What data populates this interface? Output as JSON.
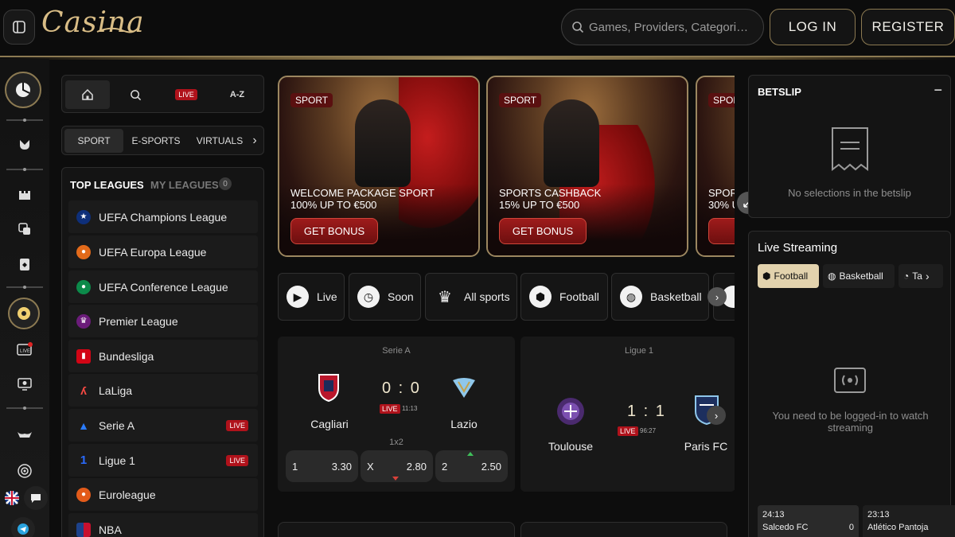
{
  "header": {
    "logo_text": "Casina",
    "search_placeholder": "Games, Providers, Categori…",
    "login_label": "LOG IN",
    "register_label": "REGISTER"
  },
  "nav": {
    "home_icon": "home-icon",
    "search_icon": "search-icon",
    "live_label": "LIVE",
    "az_label": "A-Z"
  },
  "tabs": [
    {
      "label": "SPORT"
    },
    {
      "label": "E-SPORTS"
    },
    {
      "label": "VIRTUALS"
    }
  ],
  "leagues": {
    "top_label": "TOP LEAGUES",
    "my_label": "MY LEAGUES",
    "my_count": "0",
    "items": [
      {
        "name": "UEFA Champions League",
        "live": ""
      },
      {
        "name": "UEFA Europa League",
        "live": ""
      },
      {
        "name": "UEFA Conference League",
        "live": ""
      },
      {
        "name": "Premier League",
        "live": ""
      },
      {
        "name": "Bundesliga",
        "live": ""
      },
      {
        "name": "LaLiga",
        "live": ""
      },
      {
        "name": "Serie A",
        "live": "LIVE"
      },
      {
        "name": "Ligue 1",
        "live": "LIVE"
      },
      {
        "name": "Euroleague",
        "live": ""
      },
      {
        "name": "NBA",
        "live": ""
      }
    ]
  },
  "banners": [
    {
      "badge": "SPORT",
      "line1": "WELCOME PACKAGE SPORT",
      "line2": "100% UP TO €500",
      "cta": "GET BONUS"
    },
    {
      "badge": "SPORT",
      "line1": "SPORTS CASHBACK",
      "line2": "15% UP TO €500",
      "cta": "GET BONUS"
    },
    {
      "badge": "SPOR",
      "line1": "SPOR",
      "line2": "30% U",
      "cta": "GE"
    }
  ],
  "sports": [
    {
      "label": "Live",
      "icon": "play-icon"
    },
    {
      "label": "Soon",
      "icon": "clock-icon"
    },
    {
      "label": "All sports",
      "icon": "trophy-icon"
    },
    {
      "label": "Football",
      "icon": "football-icon"
    },
    {
      "label": "Basketball",
      "icon": "basketball-icon"
    }
  ],
  "matches": [
    {
      "league": "Serie A",
      "home": "Cagliari",
      "away": "Lazio",
      "score": "0 : 0",
      "live": "LIVE",
      "time": "11:13",
      "market": "1x2",
      "odds": [
        {
          "label": "1",
          "value": "3.30"
        },
        {
          "label": "X",
          "value": "2.80"
        },
        {
          "label": "2",
          "value": "2.50"
        }
      ]
    },
    {
      "league": "Ligue 1",
      "home": "Toulouse",
      "away": "Paris FC",
      "score": "1 : 1",
      "live": "LIVE",
      "time": "96:27"
    }
  ],
  "betslip": {
    "title": "BETSLIP",
    "collapse": "−",
    "empty_text": "No selections in the betslip"
  },
  "streaming": {
    "title": "Live Streaming",
    "tabs": [
      {
        "label": "Football"
      },
      {
        "label": "Basketball"
      },
      {
        "label": "Ta"
      }
    ],
    "login_msg": "You need to be logged-in to watch streaming",
    "mini": [
      {
        "time": "24:13",
        "team": "Salcedo FC",
        "score": "0"
      },
      {
        "time": "23:13",
        "team": "Atlético Pantoja",
        "score": ""
      }
    ]
  },
  "colors": {
    "accent": "#8c7a52",
    "gold": "#d9bd86",
    "live_red": "#b0121b",
    "background": "#0d0d0d"
  }
}
